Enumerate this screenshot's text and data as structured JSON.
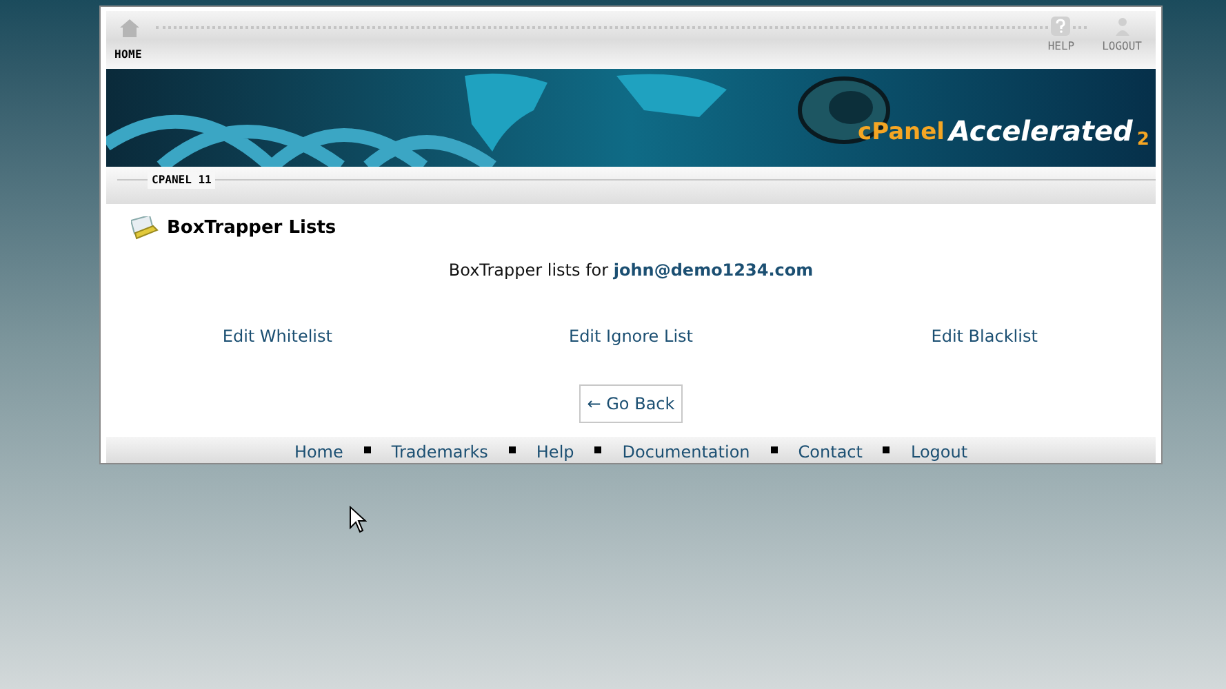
{
  "header": {
    "home_label": "HOME",
    "help_label": "HELP",
    "logout_label": "LOGOUT"
  },
  "banner": {
    "logo_word": "cPanel",
    "logo_product": "Accelerated",
    "logo_version": "2"
  },
  "section_bar": {
    "label": "CPANEL 11"
  },
  "page": {
    "title": "BoxTrapper Lists",
    "intro": "BoxTrapper lists for",
    "email": "john@demo1234.com",
    "links": [
      {
        "label": "Edit Whitelist"
      },
      {
        "label": "Edit Ignore List"
      },
      {
        "label": "Edit Blacklist"
      }
    ],
    "back_button": {
      "arrow": "←",
      "label": "Go Back"
    }
  },
  "footer": {
    "links": [
      {
        "label": "Home"
      },
      {
        "label": "Trademarks"
      },
      {
        "label": "Help"
      },
      {
        "label": "Documentation"
      },
      {
        "label": "Contact"
      },
      {
        "label": "Logout"
      }
    ]
  }
}
